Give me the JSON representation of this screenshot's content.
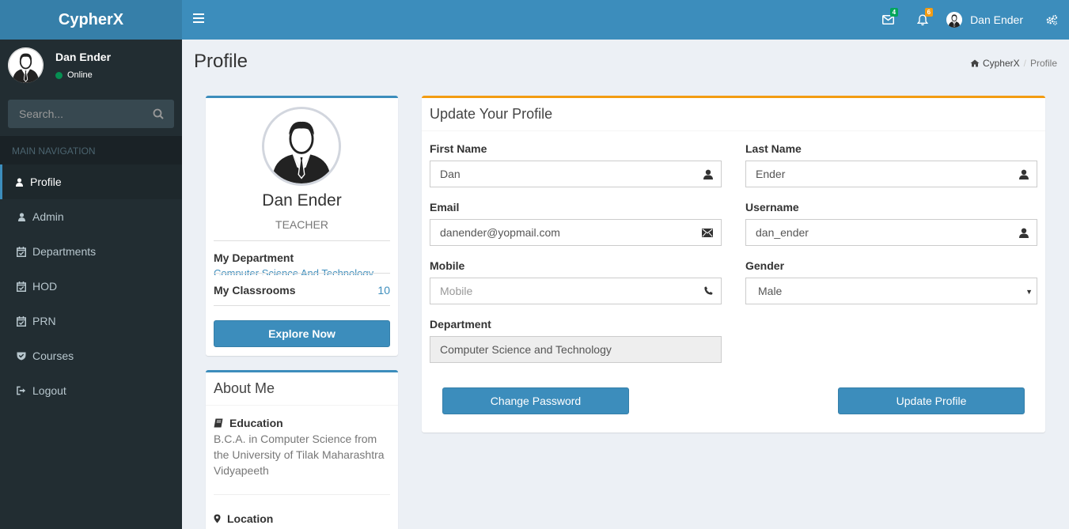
{
  "app": {
    "brand": "CypherX"
  },
  "header": {
    "messages_count": "4",
    "notifications_count": "6",
    "user_name": "Dan Ender",
    "colors": {
      "bar": "#3c8dbc",
      "logo": "#367fa9",
      "messages_badge": "#00a65a",
      "notifications_badge": "#f39c12"
    }
  },
  "sidebar": {
    "user_name": "Dan Ender",
    "status": "Online",
    "search_placeholder": "Search...",
    "nav_header": "MAIN NAVIGATION",
    "items": [
      {
        "label": "Profile",
        "icon": "user-icon",
        "active": true
      },
      {
        "label": "Admin",
        "icon": "user-icon"
      },
      {
        "label": "Departments",
        "icon": "calendar-check-icon"
      },
      {
        "label": "HOD",
        "icon": "calendar-check-icon"
      },
      {
        "label": "PRN",
        "icon": "calendar-check-icon"
      },
      {
        "label": "Courses",
        "icon": "shield-check-icon"
      },
      {
        "label": "Logout",
        "icon": "sign-out-icon"
      }
    ]
  },
  "page": {
    "title": "Profile",
    "breadcrumb": {
      "home": "CypherX",
      "current": "Profile"
    }
  },
  "profile_card": {
    "name": "Dan Ender",
    "role": "TEACHER",
    "department_label": "My Department",
    "department_value": "Computer Science And Technology",
    "classrooms_label": "My Classrooms",
    "classrooms_count": "10",
    "explore_button": "Explore Now"
  },
  "about": {
    "title": "About Me",
    "education_label": "Education",
    "education_text": "B.C.A. in Computer Science from the University of Tilak Maharashtra Vidyapeeth",
    "location_label": "Location"
  },
  "form": {
    "title": "Update Your Profile",
    "first_name": {
      "label": "First Name",
      "value": "Dan"
    },
    "last_name": {
      "label": "Last Name",
      "value": "Ender"
    },
    "email": {
      "label": "Email",
      "value": "danender@yopmail.com"
    },
    "username": {
      "label": "Username",
      "value": "dan_ender"
    },
    "mobile": {
      "label": "Mobile",
      "value": "",
      "placeholder": "Mobile"
    },
    "gender": {
      "label": "Gender",
      "value": "Male"
    },
    "department": {
      "label": "Department",
      "value": "Computer Science and Technology"
    },
    "change_password_button": "Change Password",
    "update_button": "Update Profile"
  }
}
